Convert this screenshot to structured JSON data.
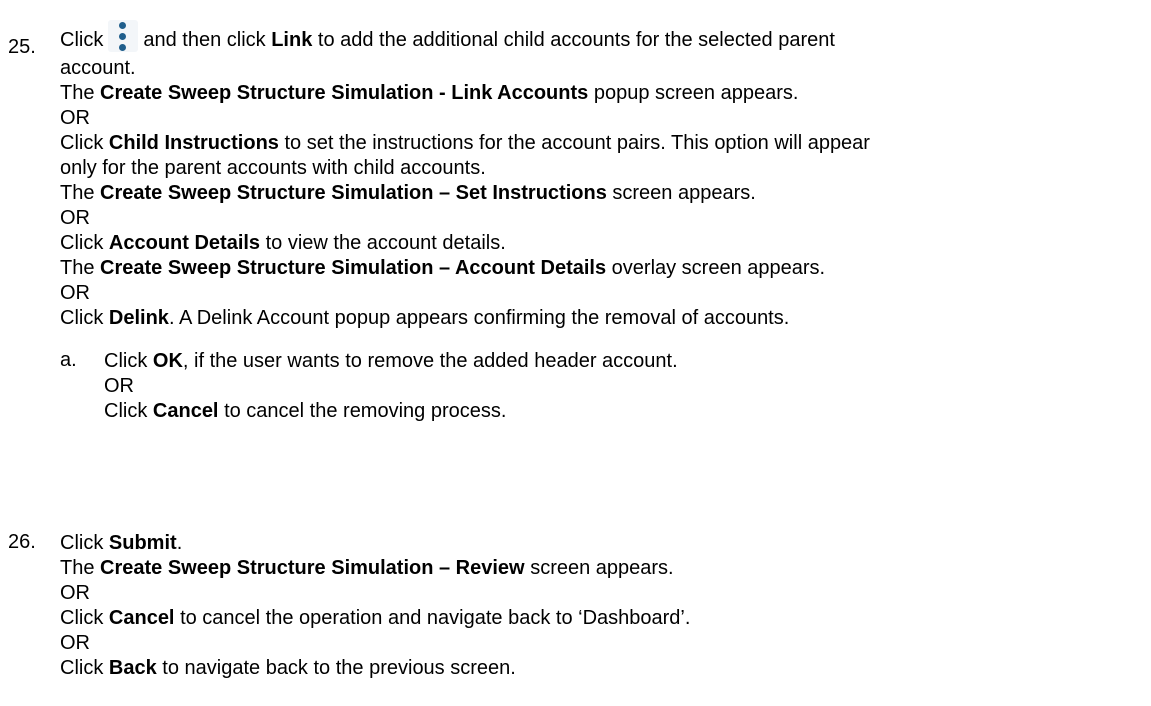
{
  "step25": {
    "number": "25.",
    "l1": {
      "pre": "Click",
      "post": "and then click",
      "b1": "Link",
      "rest": "to add the additional child accounts for the selected parent"
    },
    "l2": "account.",
    "l3": {
      "pre": "The",
      "b": "Create Sweep Structure Simulation - Link Accounts",
      "post": "popup screen appears."
    },
    "or1": "OR",
    "l5": {
      "pre": "Click",
      "b": "Child Instructions",
      "post": "to set the instructions for the account pairs. This option will appear"
    },
    "l6": "only for the parent accounts with child accounts.",
    "l7": {
      "pre": "The",
      "b": "Create Sweep Structure Simulation – Set Instructions",
      "post": "screen appears."
    },
    "or2": "OR",
    "l9": {
      "pre": "Click",
      "b": "Account Details",
      "post": "to view the account details."
    },
    "l10": {
      "pre": "The",
      "b": "Create Sweep Structure Simulation – Account Details",
      "post": "overlay screen appears."
    },
    "or3": "OR",
    "l12": {
      "pre": "Click",
      "b": "Delink",
      "post": ". A Delink Account popup appears confirming the removal of accounts."
    },
    "sub": {
      "label": "a.",
      "s1": {
        "pre": "Click",
        "b": "OK",
        "post": ", if the user wants to remove the added header account."
      },
      "or": "OR",
      "s3": {
        "pre": "Click",
        "b": "Cancel",
        "post": "to cancel the removing process."
      }
    },
    "icon": "kebab-menu-icon"
  },
  "step26": {
    "number": "26.",
    "l1": {
      "pre": "Click",
      "b": "Submit",
      "post": "."
    },
    "l2": {
      "pre": "The",
      "b": "Create Sweep Structure Simulation – Review",
      "post": "screen appears."
    },
    "or1": "OR",
    "l4": {
      "pre": "Click",
      "b": "Cancel",
      "post": "to cancel the operation and navigate back to ‘Dashboard’."
    },
    "or2": "OR",
    "l6": {
      "pre": "Click",
      "b": "Back",
      "post": "to navigate back to the previous screen."
    }
  }
}
